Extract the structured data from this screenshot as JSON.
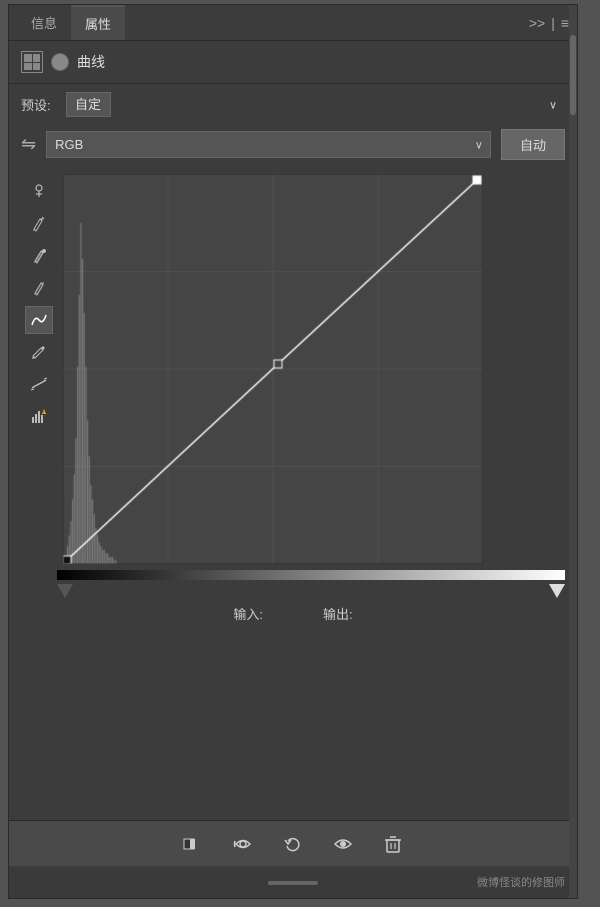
{
  "tabs": {
    "info_label": "信息",
    "properties_label": "属性"
  },
  "header": {
    "title": "曲线",
    "expand_icon": ">>",
    "divider": "|",
    "menu_icon": "≡"
  },
  "preset": {
    "label": "预设:",
    "value": "自定",
    "chevron": "∨"
  },
  "channel": {
    "value": "RGB",
    "chevron": "∨",
    "auto_label": "自动"
  },
  "tools": [
    {
      "name": "eyedropper-point",
      "symbol": "✦"
    },
    {
      "name": "eyedropper-white",
      "symbol": "✦"
    },
    {
      "name": "eyedropper-black",
      "symbol": "✦"
    },
    {
      "name": "curve-tool",
      "symbol": "∿"
    },
    {
      "name": "pencil-tool",
      "symbol": "✏"
    },
    {
      "name": "smooth-tool",
      "symbol": "~"
    },
    {
      "name": "warning-tool",
      "symbol": "⚠"
    }
  ],
  "io": {
    "input_label": "输入:",
    "output_label": "输出:"
  },
  "bottom_toolbar": {
    "clip_shadow": "clip-shadow",
    "clip_highlight": "clip-highlight",
    "reset": "reset",
    "visibility": "visibility",
    "delete": "delete"
  },
  "watermark": "微博怪谈的修图师",
  "colors": {
    "background": "#3c3c3c",
    "panel": "#454545",
    "accent": "#666",
    "grid": "#555"
  }
}
